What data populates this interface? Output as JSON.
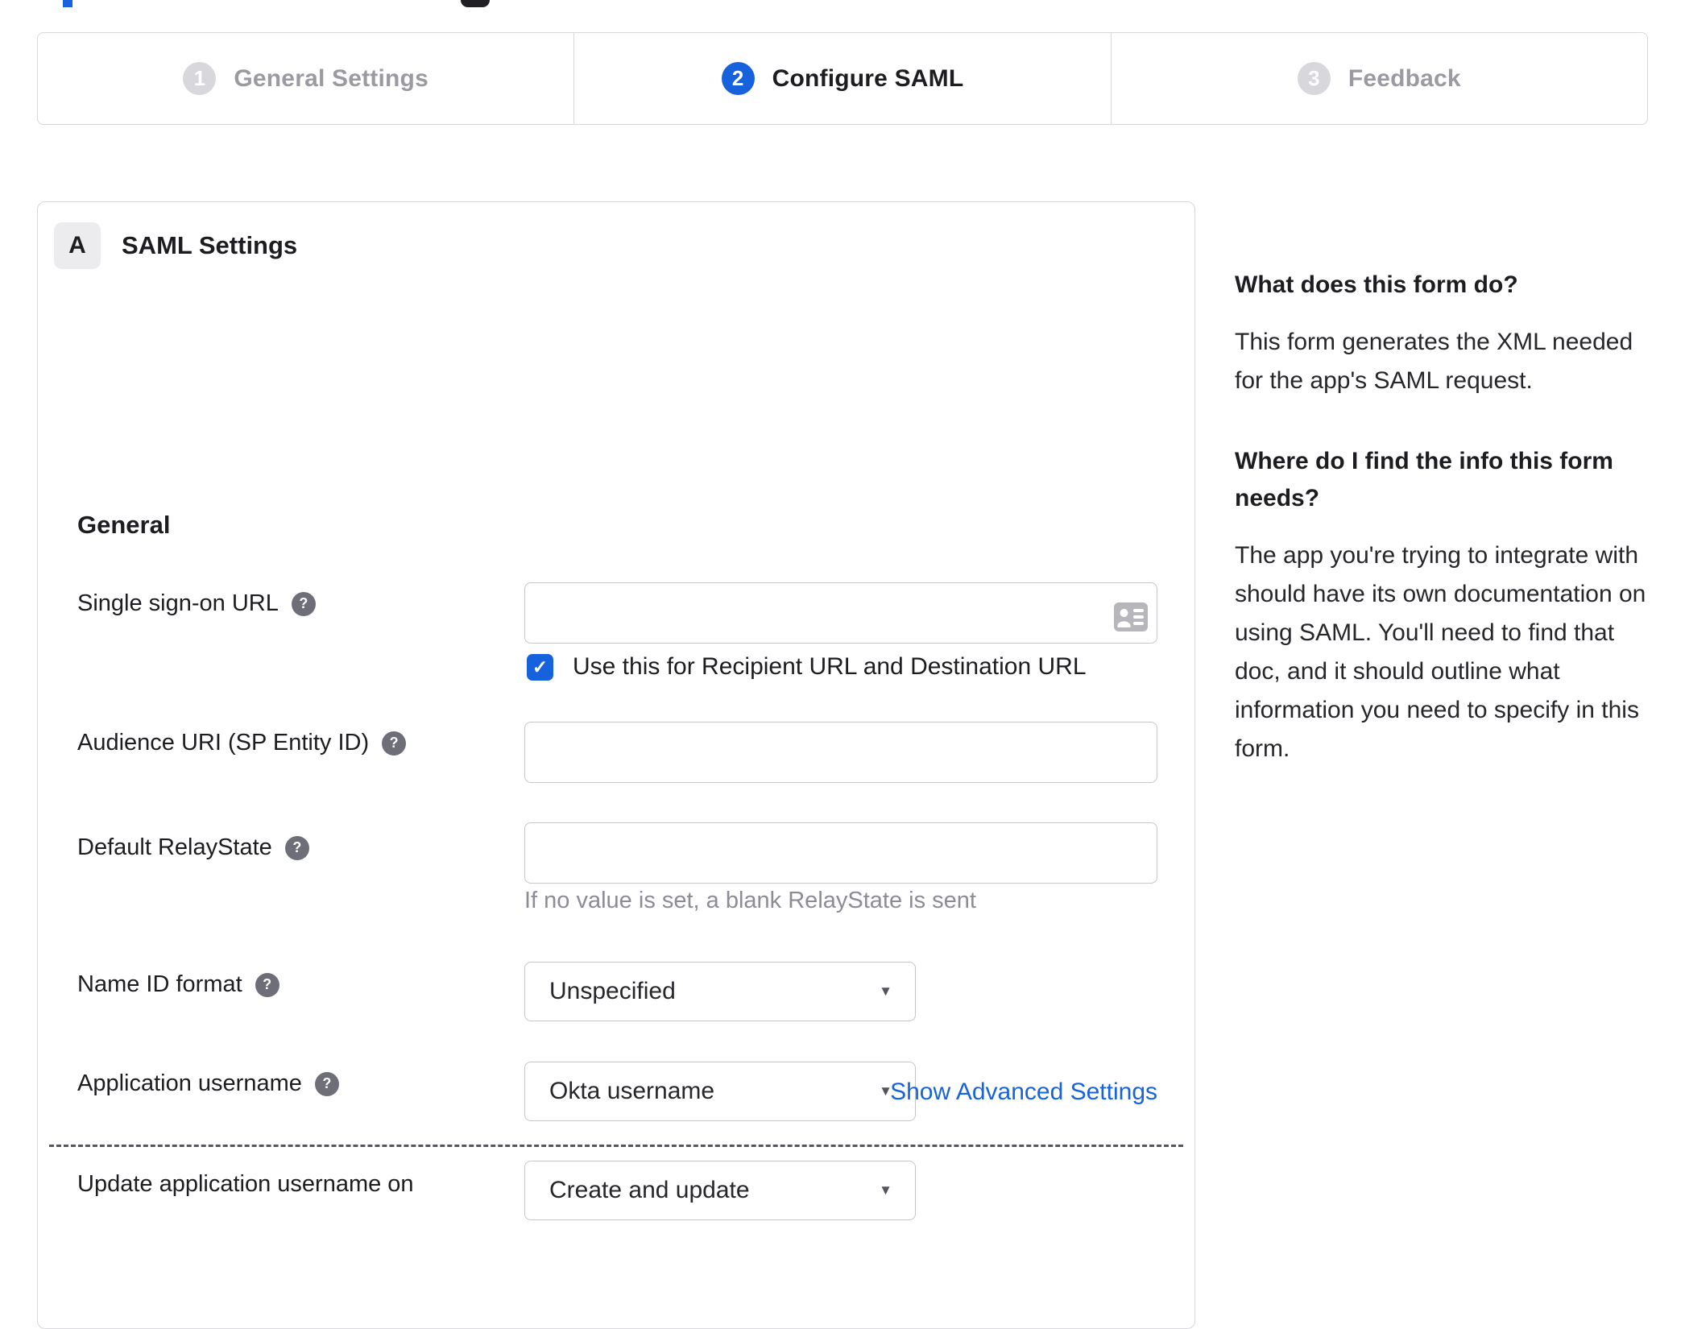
{
  "colors": {
    "accent_blue": "#1662dd",
    "text_dark": "#1d1d21",
    "text_muted": "#8c8c96",
    "border_gray": "#d7d7dc"
  },
  "glyphs": {
    "help": "?",
    "dropdown_arrow": "▼",
    "check": "✓"
  },
  "stepper": {
    "steps": [
      {
        "number": "1",
        "label": "General Settings",
        "state": "inactive"
      },
      {
        "number": "2",
        "label": "Configure SAML",
        "state": "active"
      },
      {
        "number": "3",
        "label": "Feedback",
        "state": "inactive"
      }
    ]
  },
  "panel": {
    "badge": "A",
    "title": "SAML Settings",
    "section_heading": "General",
    "fields": {
      "sso": {
        "label": "Single sign-on URL",
        "value": "",
        "checkbox_label": "Use this for Recipient URL and Destination URL",
        "checkbox_checked": true
      },
      "audience": {
        "label": "Audience URI (SP Entity ID)",
        "value": ""
      },
      "relay": {
        "label": "Default RelayState",
        "value": "",
        "hint": "If no value is set, a blank RelayState is sent"
      },
      "nameid": {
        "label": "Name ID format",
        "value": "Unspecified"
      },
      "appuser": {
        "label": "Application username",
        "value": "Okta username"
      },
      "updateuser": {
        "label": "Update application username on",
        "value": "Create and update"
      }
    },
    "advanced_link": "Show Advanced Settings"
  },
  "help_sidebar": {
    "sections": [
      {
        "heading": "What does this form do?",
        "body": "This form generates the XML needed for the app's SAML request."
      },
      {
        "heading": "Where do I find the info this form needs?",
        "body": "The app you're trying to integrate with should have its own documentation on using SAML. You'll need to find that doc, and it should outline what information you need to specify in this form."
      }
    ]
  }
}
